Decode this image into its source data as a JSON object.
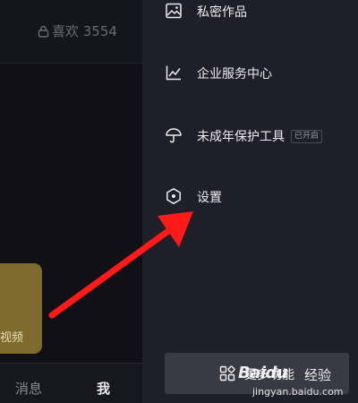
{
  "profile": {
    "likes_label": "喜欢 3554",
    "promo_text": "视频"
  },
  "bottom_nav": {
    "messages": "消息",
    "me": "我"
  },
  "drawer": {
    "items": [
      {
        "label": "私密作品",
        "icon": "image-icon"
      },
      {
        "label": "企业服务中心",
        "icon": "chart-line-icon"
      },
      {
        "label": "未成年保护工具",
        "icon": "umbrella-icon",
        "badge": "已开启"
      },
      {
        "label": "设置",
        "icon": "settings-hexagon-icon"
      }
    ],
    "more_button": {
      "label": "更多功能",
      "icon": "grid-icon"
    }
  },
  "watermark": {
    "logo": "Baidu",
    "title": "经验",
    "url": "jingyan.baidu.com"
  },
  "colors": {
    "drawer_bg": "#1f1f29",
    "left_bg": "#121219",
    "arrow": "#ff1a1a",
    "promo_card": "#7d6a2c"
  }
}
